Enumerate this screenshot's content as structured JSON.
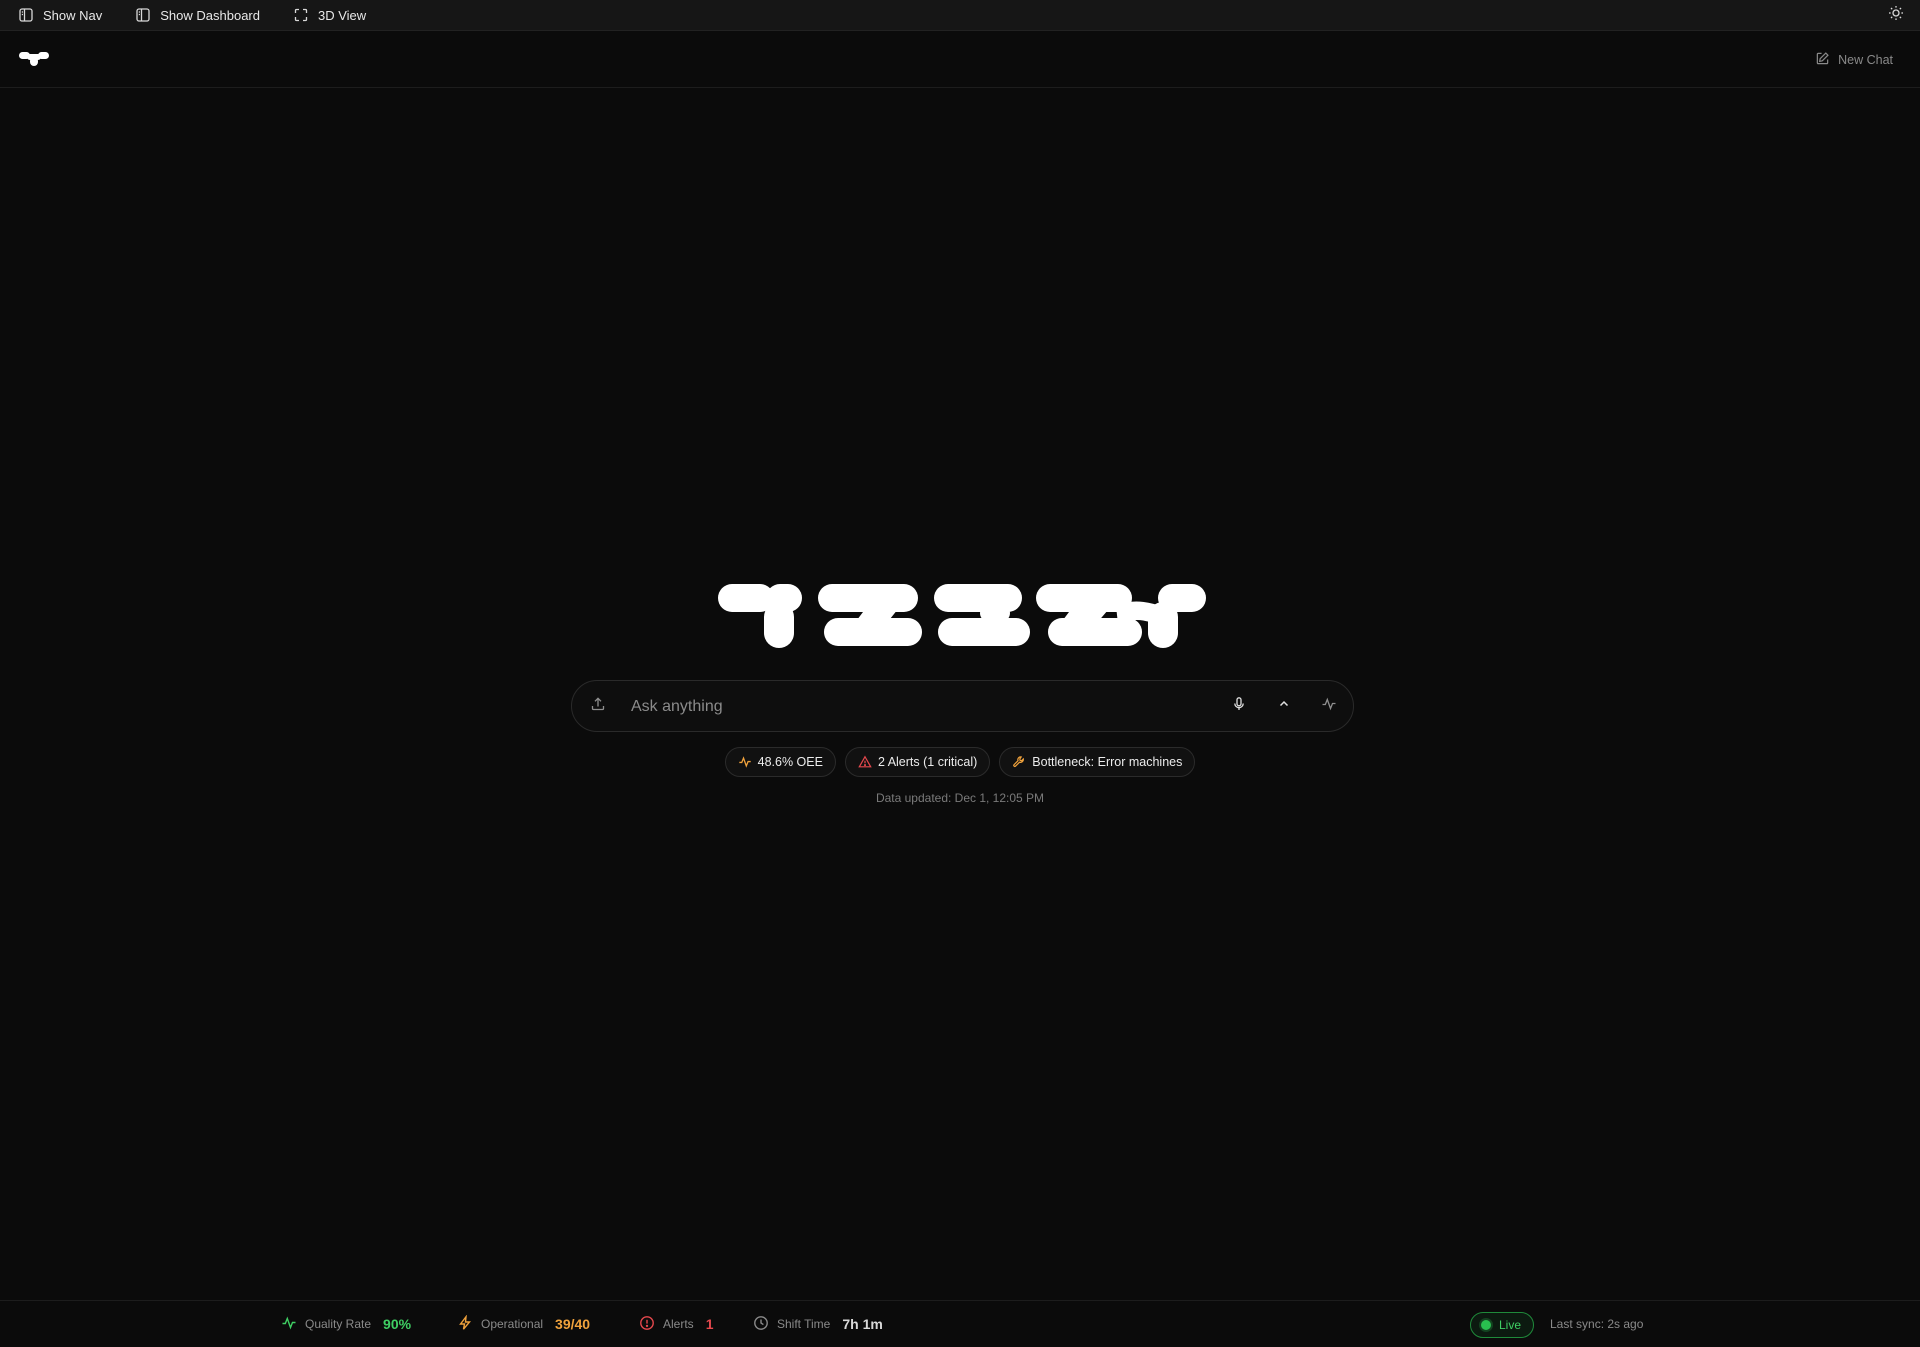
{
  "topbar": {
    "buttons": [
      {
        "label": "Show Nav",
        "icon": "sidebar-icon"
      },
      {
        "label": "Show Dashboard",
        "icon": "sidebar-icon"
      },
      {
        "label": "3D View",
        "icon": "expand-icon"
      }
    ],
    "theme_icon": "sun-icon"
  },
  "header": {
    "brand_icon": "brand-mark-icon",
    "new_chat_label": "New Chat",
    "new_chat_icon": "edit-icon"
  },
  "hero": {
    "logo_name": "brand-wordmark",
    "search": {
      "placeholder": "Ask anything",
      "value": "",
      "upload_icon": "upload-icon",
      "mic_icon": "mic-icon",
      "chevron_icon": "chevron-up-icon",
      "pulse_icon": "pulse-icon"
    },
    "chips": [
      {
        "label": "48.6% OEE",
        "icon": "pulse-icon",
        "color": "#f0a23c"
      },
      {
        "label": "2 Alerts (1 critical)",
        "icon": "alert-triangle-icon",
        "color": "#e5484d"
      },
      {
        "label": "Bottleneck: Error machines",
        "icon": "wrench-icon",
        "color": "#f0a23c"
      }
    ],
    "data_updated": "Data updated: Dec 1, 12:05 PM"
  },
  "status": {
    "quality": {
      "label": "Quality Rate",
      "value": "90%",
      "color": "#3fcf63",
      "icon": "pulse-icon"
    },
    "operational": {
      "label": "Operational",
      "value": "39/40",
      "color": "#f0a23c",
      "icon": "bolt-icon"
    },
    "alerts": {
      "label": "Alerts",
      "value": "1",
      "color": "#e5484d",
      "icon": "alert-circle-icon"
    },
    "shift": {
      "label": "Shift Time",
      "value": "7h 1m",
      "color": "#d9d9d9",
      "icon": "clock-icon"
    },
    "live_label": "Live",
    "last_sync": "Last sync: 2s ago"
  }
}
